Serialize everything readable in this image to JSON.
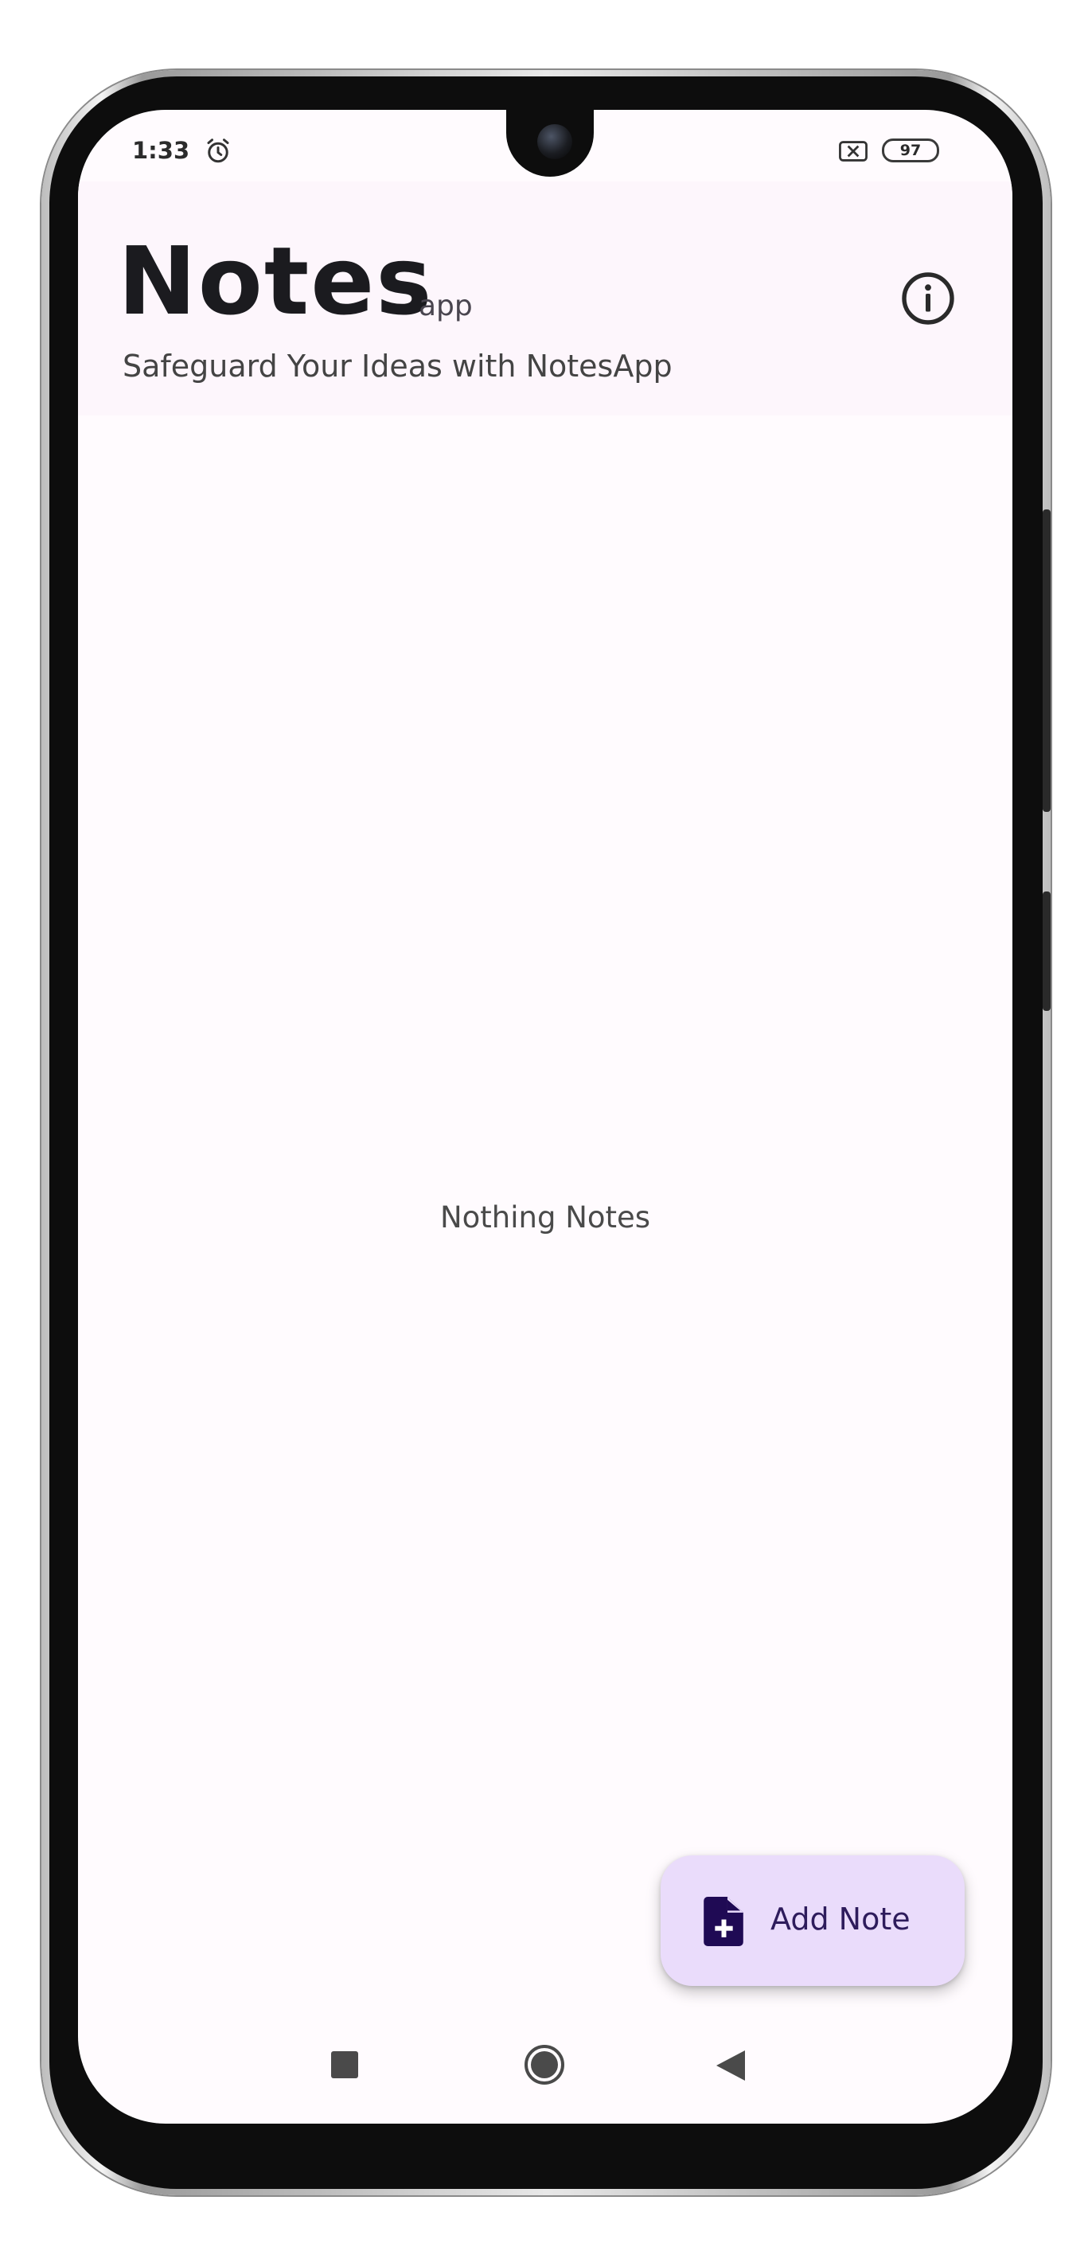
{
  "status_bar": {
    "time": "1:33",
    "battery_level": "97",
    "icons": [
      "alarm-icon",
      "sim-absent-icon",
      "battery-icon"
    ]
  },
  "header": {
    "title": "Notes",
    "title_suffix": "app",
    "subtitle": "Safeguard Your Ideas with NotesApp",
    "info_icon": "info-icon"
  },
  "main": {
    "empty_message": "Nothing Notes"
  },
  "fab": {
    "label": "Add Note",
    "icon": "note-add-icon"
  },
  "nav_bar": {
    "icons": [
      "recents-icon",
      "home-icon",
      "back-icon"
    ]
  },
  "colors": {
    "header_bg": "#fdf6fc",
    "fab_bg": "#eadcfb",
    "fab_icon": "#1f0a54",
    "text_primary": "#1b1b1f"
  }
}
